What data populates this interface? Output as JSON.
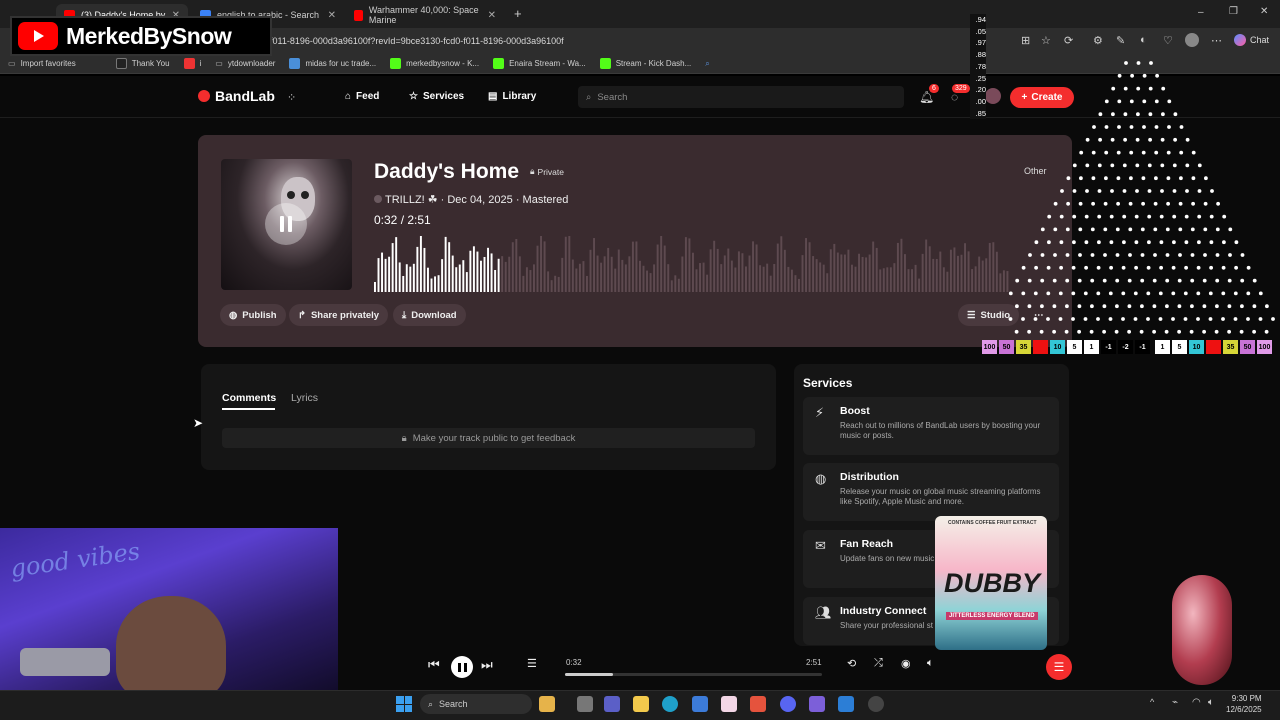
{
  "browser": {
    "tabs": [
      {
        "label": "(3) Daddy's Home by",
        "extra": "TRILL"
      },
      {
        "label": "english to arabic - Search"
      },
      {
        "label": "Warhammer 40,000: Space Marine"
      }
    ],
    "url": "f011-8196-000d3a96100f?revId=9bce3130-fcd0-f011-8196-000d3a96100f",
    "chat_label": "Chat",
    "bookmarks": [
      "Import favorites",
      "Thank You",
      "i",
      "ytdownloader",
      "midas for uc trade...",
      "merkedbysnow - K...",
      "Enaira Stream - Wa...",
      "Stream - Kick Dash..."
    ]
  },
  "overlay": {
    "channel_name": "MerkedBySnow",
    "stats": [
      ".94",
      ".05",
      ".97",
      ".88",
      ".78",
      ".25",
      ".20",
      ".00",
      ".85"
    ],
    "counters_left": [
      "100",
      "50",
      "35",
      "",
      "10",
      "5",
      "1",
      "-1",
      "-2",
      "-1"
    ],
    "counters_right": [
      "1",
      "5",
      "10",
      "",
      "35",
      "50",
      "100"
    ],
    "can_text": "DUBBY",
    "can_sub": "CONTAINS COFFEE FRUIT EXTRACT",
    "can_blend": "JITTERLESS ENERGY BLEND"
  },
  "nav": {
    "logo": "BandLab",
    "links": [
      "Feed",
      "Services",
      "Library"
    ],
    "search_placeholder": "Search",
    "notif_count": "6",
    "msg_count": "329",
    "create_label": "Create"
  },
  "track": {
    "title": "Daddy's Home",
    "visibility": "Private",
    "artist": "TRILLZ!",
    "date_status": "· Dec 04, 2025 · Mastered",
    "current_time": "0:32",
    "separator": " / ",
    "duration": "2:51",
    "genre": "Other",
    "progress": 0.187,
    "buttons": {
      "publish": "Publish",
      "share": "Share privately",
      "download": "Download",
      "studio": "Studio"
    }
  },
  "comments": {
    "tabs": [
      "Comments",
      "Lyrics"
    ],
    "active_tab": "Comments",
    "feedback_msg": "Make your track public to get feedback"
  },
  "services": {
    "title": "Services",
    "items": [
      {
        "name": "Boost",
        "desc": "Reach out to millions of BandLab users by boosting your music or posts."
      },
      {
        "name": "Distribution",
        "desc": "Release your music on global music streaming platforms like Spotify, Apple Music and more."
      },
      {
        "name": "Fan Reach",
        "desc": "Update fans on new music or simply reach out to connect."
      },
      {
        "name": "Industry Connect",
        "desc": "Share your professional st representation, record de"
      }
    ]
  },
  "player": {
    "current_time": "0:32",
    "duration": "2:51",
    "progress": 0.187
  },
  "taskbar": {
    "search_label": "Search",
    "time": "9:30 PM",
    "date": "12/6/2025"
  },
  "colors": {
    "accent": "#f42d2d",
    "card_bg": "#3a2b2f"
  }
}
